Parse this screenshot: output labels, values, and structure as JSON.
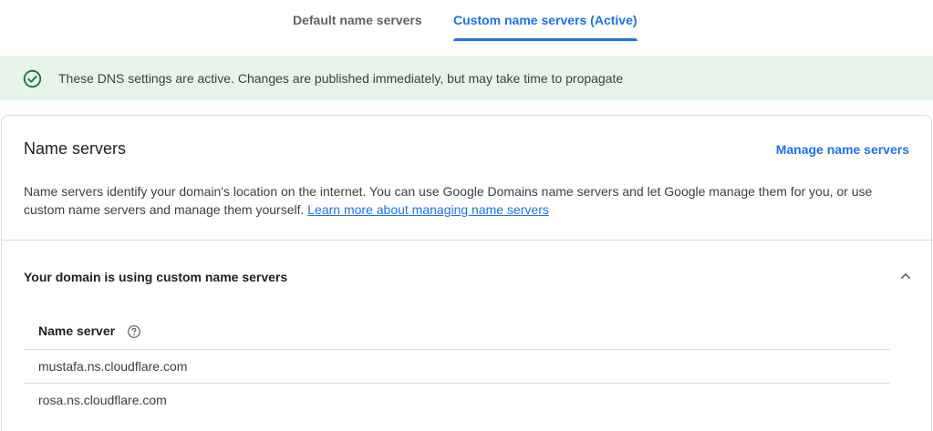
{
  "tabs": {
    "default_label": "Default name servers",
    "custom_label": "Custom name servers (Active)"
  },
  "banner": {
    "icon": "check-circle-icon",
    "text": "These DNS settings are active. Changes are published immediately, but may take time to propagate",
    "color": "#e6f4ea",
    "icon_color": "#188038"
  },
  "card": {
    "title": "Name servers",
    "manage_link": "Manage name servers",
    "description": "Name servers identify your domain's location on the internet. You can use Google Domains name servers and let Google manage them for you, or use custom name servers and manage them yourself.",
    "learn_more": "Learn more about managing name servers"
  },
  "section": {
    "title": "Your domain is using custom name servers",
    "chevron_icon": "chevron-up-icon"
  },
  "table": {
    "header": "Name server",
    "help_icon": "help-circle-icon",
    "rows": [
      "mustafa.ns.cloudflare.com",
      "rosa.ns.cloudflare.com"
    ]
  },
  "colors": {
    "accent": "#1a73e8",
    "divider": "#dadce0"
  }
}
